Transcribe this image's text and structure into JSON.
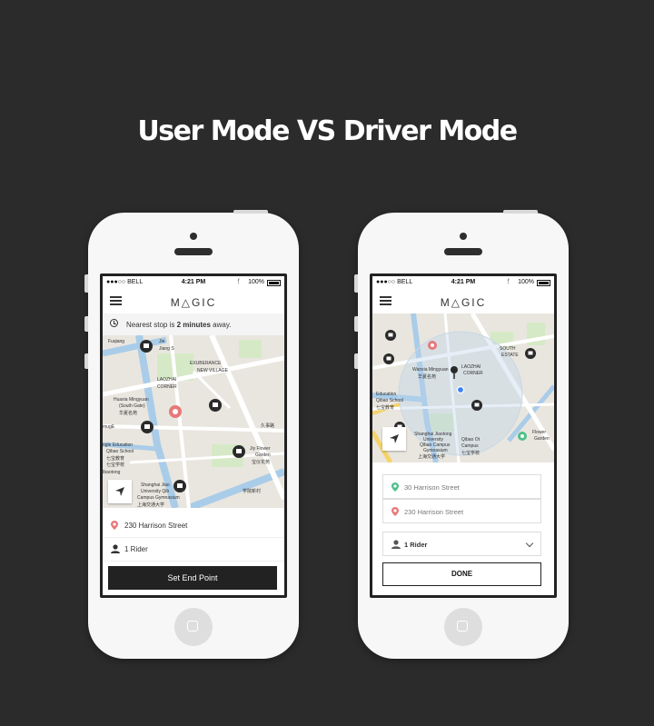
{
  "headline": "User Mode  VS Driver Mode",
  "colors": {
    "background": "#2b2b2b",
    "accent_pin": "#e8787a",
    "driver_pin": "#4fbf8a",
    "button_dark": "#222222"
  },
  "status_bar": {
    "carrier": "●●●○○ BELL",
    "time": "4:21 PM",
    "battery": "100%"
  },
  "app": {
    "logo": "M△GIC"
  },
  "user_mode": {
    "notice_prefix": "Nearest stop is ",
    "notice_bold": "2 minutes",
    "notice_suffix": " away.",
    "map_labels": [
      "Fuqiang",
      "Jie",
      "Jiang S",
      "EXUBERANCE",
      "NEW VILLAGE",
      "LAOZHAI",
      "CORNER",
      "Huaxia Mingyuan",
      "(South Gate)",
      "华夏名苑",
      "ngle Education",
      "Qibao School",
      "七宝教育",
      "七宝学校",
      "Ibaotong",
      "Shanghai Jiao",
      "University Qib",
      "Campus Gymnasium",
      "上海交通大学",
      "Jiy Flower",
      "Garden",
      "宝仪花苑",
      "学院新村",
      "久事路",
      "mugE"
    ],
    "destination": "230 Harrison Street",
    "riders": "1 Rider",
    "button": "Set End Point"
  },
  "driver_mode": {
    "map_labels": [
      "Wanxia Mingyuan",
      "华夏名苑",
      "Education",
      "Qibao School",
      "七宝教育",
      "Shanghai Jiaotong",
      "University",
      "Qibao Campus",
      "Gymnasium",
      "上海交通大学",
      "Qibao Ot",
      "Campus",
      "七宝学校",
      "LAOZHAI",
      "CORNER",
      "SOUTH",
      "ESTATE",
      "Flower",
      "Garden"
    ],
    "pickup": "30 Harrison Street",
    "destination": "230 Harrison Street",
    "riders": "1 Rider",
    "button": "DONE"
  }
}
